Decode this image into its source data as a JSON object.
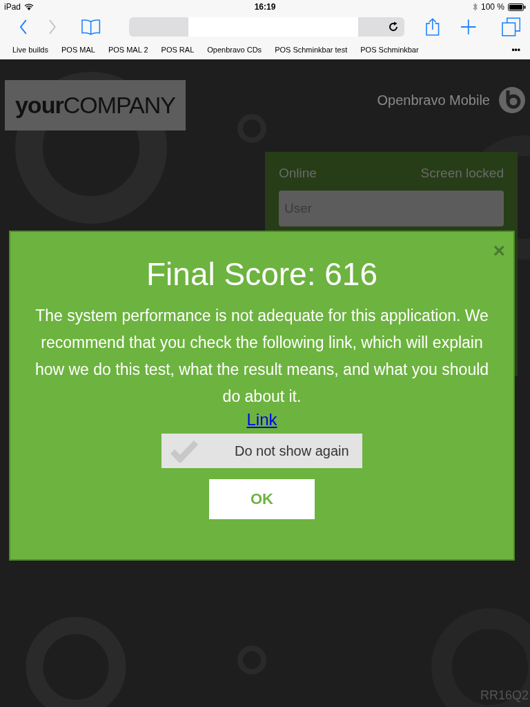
{
  "status_bar": {
    "device": "iPad",
    "time": "16:19",
    "battery": "100 %"
  },
  "bookmarks": [
    "Live builds",
    "POS MAL",
    "POS MAL 2",
    "POS RAL",
    "Openbravo CDs",
    "POS Schminkbar test",
    "POS Schminkbar"
  ],
  "more": "•••",
  "header": {
    "logo": "**your**COMPANY",
    "app_name": "Openbravo Mobile"
  },
  "login": {
    "status": "Online",
    "state": "Screen locked",
    "user_placeholder": "User"
  },
  "dialog": {
    "close": "×",
    "title": "Final Score: 616",
    "message": "The system performance is not adequate for this application. We recommend that you check the following link, which will explain how we do this test, what the result means, and what you should do about it.",
    "link": "Link",
    "checkbox": {
      "label": "Do not show again",
      "checked": false
    },
    "ok": "OK"
  },
  "version": "RR16Q2"
}
